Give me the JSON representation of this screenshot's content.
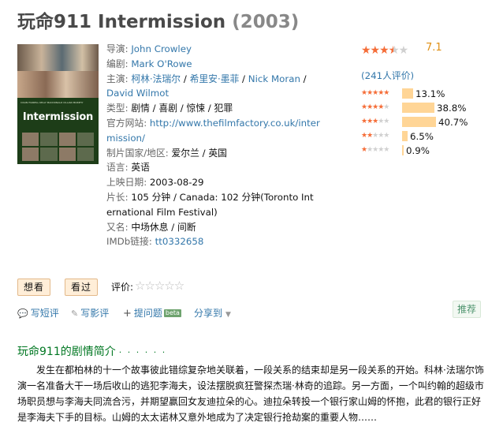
{
  "title": {
    "name": "玩命911 Intermission",
    "year": "(2003)"
  },
  "poster": {
    "title_text": "Intermission",
    "cast_line": "COLIN FARRELL  KELLY MACDONALD  CILLIAN MURPHY"
  },
  "info": {
    "director": {
      "label": "导演:",
      "value": "John Crowley"
    },
    "writer": {
      "label": "编剧:",
      "value": "Mark O'Rowe"
    },
    "cast": {
      "label": "主演:",
      "names": [
        "柯林·法瑞尔",
        "希里安·墨菲",
        "Nick Moran",
        "David Wilmot"
      ]
    },
    "genre": {
      "label": "类型:",
      "value": "剧情 / 喜剧 / 惊悚 / 犯罪"
    },
    "website": {
      "label": "官方网站:",
      "line1": "http://www.thefilmfactory.co.uk/inter",
      "line2": "mission/"
    },
    "country": {
      "label": "制片国家/地区:",
      "value": "爱尔兰 / 英国"
    },
    "language": {
      "label": "语言:",
      "value": "英语"
    },
    "release": {
      "label": "上映日期:",
      "value": "2003-08-29"
    },
    "runtime": {
      "label": "片长:",
      "line1": "105 分钟 / Canada: 102 分钟(Toronto Int",
      "line2": "ernational Film Festival)"
    },
    "aka": {
      "label": "又名:",
      "value": "中场休息 / 间断"
    },
    "imdb": {
      "label": "IMDb链接:",
      "value": "tt0332658"
    }
  },
  "rating": {
    "score": "7.1",
    "stars_value": 3.5,
    "votes": "(241人评价)",
    "distribution": [
      {
        "stars": 5,
        "percent": "13.1%",
        "value": 13.1
      },
      {
        "stars": 4,
        "percent": "38.8%",
        "value": 38.8
      },
      {
        "stars": 3,
        "percent": "40.7%",
        "value": 40.7
      },
      {
        "stars": 2,
        "percent": "6.5%",
        "value": 6.5
      },
      {
        "stars": 1,
        "percent": "0.9%",
        "value": 0.9
      }
    ]
  },
  "interest": {
    "wish_label": "想看",
    "seen_label": "看过",
    "rate_label": "评价:"
  },
  "actions": {
    "short_review": "写短评",
    "review": "写影评",
    "question": "提问题",
    "beta": "beta",
    "share": "分享到",
    "recommend": "推荐"
  },
  "colors": {
    "link": "#3377aa",
    "star": "#f56d38",
    "section_title": "#007722",
    "bar": "#ffd596"
  },
  "summary": {
    "heading": "玩命911的剧情简介",
    "dots": "· · · · · ·",
    "text": "发生在都柏林的十一个故事彼此错综复杂地关联着，一段关系的结束却是另一段关系的开始。科林·法瑞尔饰演一名准备大干一场后收山的逃犯李海夫，设法摆脱疯狂警探杰瑞·林奇的追踪。另一方面，一个叫约翰的超级市场职员想与李海夫同流合污，并期望赢回女友迪拉朵的心。迪拉朵转投一个银行家山姆的怀抱，此君的银行正好是李海夫下手的目标。山姆的太太诺林又意外地成为了决定银行抢劫案的重要人物……"
  }
}
